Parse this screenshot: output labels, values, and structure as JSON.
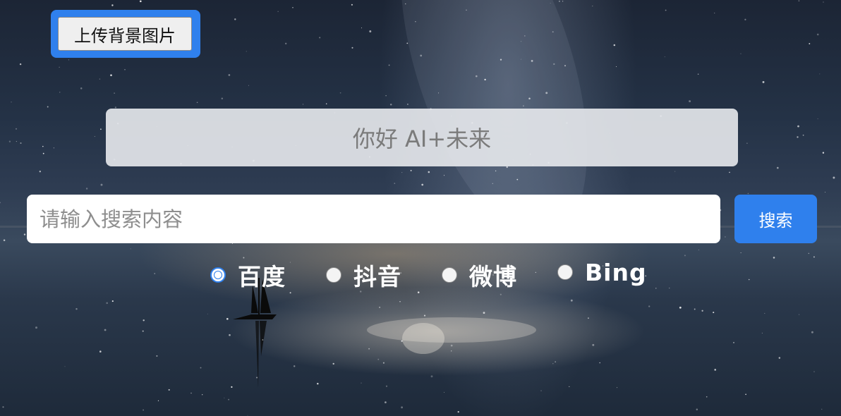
{
  "upload": {
    "label": "上传背景图片"
  },
  "banner": {
    "text": "你好 AI+未来"
  },
  "search": {
    "placeholder": "请输入搜索内容",
    "value": "",
    "button_label": "搜索"
  },
  "engines": [
    {
      "label": "百度",
      "checked": true
    },
    {
      "label": "抖音",
      "checked": false
    },
    {
      "label": "微博",
      "checked": false
    },
    {
      "label": "Bing",
      "checked": false
    }
  ],
  "colors": {
    "accent": "#2f80ed",
    "banner_bg": "#e4e6ea",
    "banner_text": "#7b7b7b"
  },
  "background": {
    "description_icon": "starry-sky-sailboat-image"
  }
}
